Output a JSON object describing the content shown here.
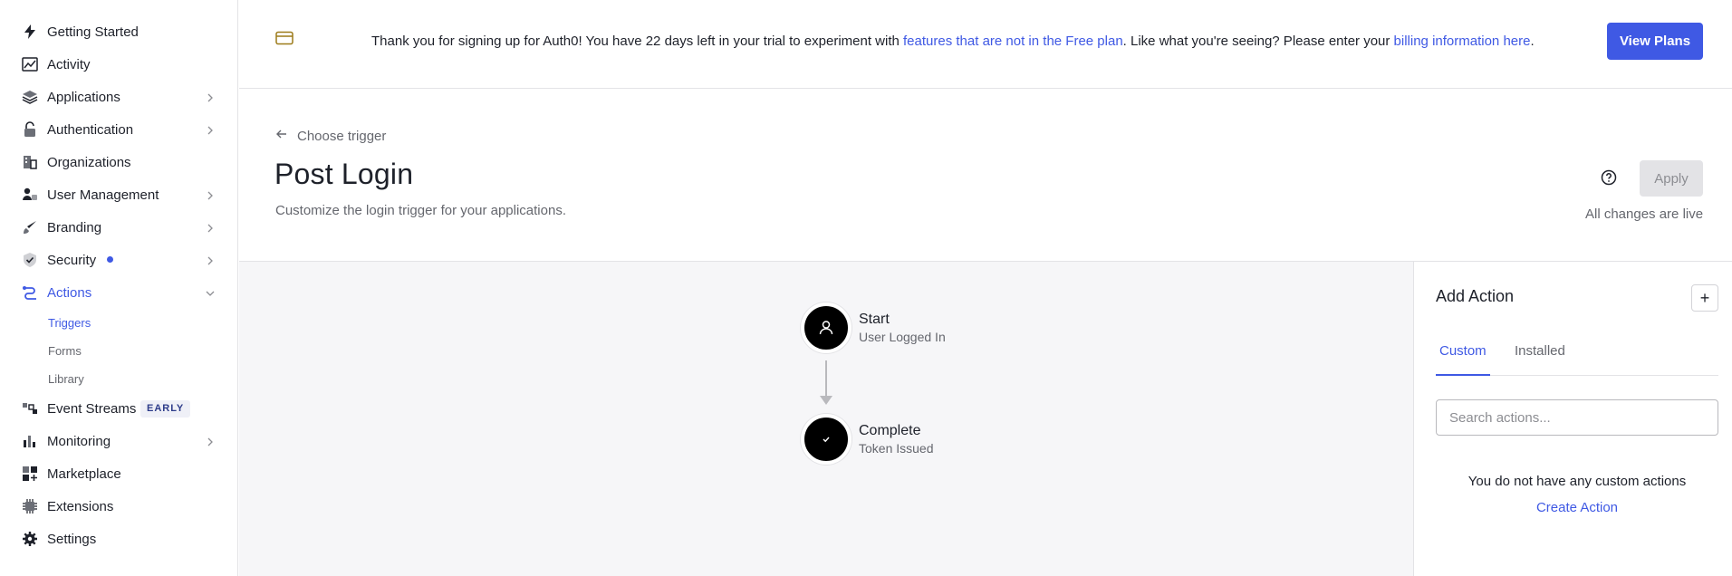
{
  "sidebar": {
    "items": [
      {
        "label": "Getting Started",
        "icon": "lightning-icon"
      },
      {
        "label": "Activity",
        "icon": "chart-line-icon"
      },
      {
        "label": "Applications",
        "icon": "layers-icon"
      },
      {
        "label": "Authentication",
        "icon": "lock-icon"
      },
      {
        "label": "Organizations",
        "icon": "building-icon"
      },
      {
        "label": "User Management",
        "icon": "users-icon"
      },
      {
        "label": "Branding",
        "icon": "brush-icon"
      },
      {
        "label": "Security",
        "icon": "shield-icon"
      },
      {
        "label": "Actions",
        "icon": "flow-icon"
      },
      {
        "label": "Event Streams",
        "icon": "stream-icon",
        "badge": "EARLY"
      },
      {
        "label": "Monitoring",
        "icon": "bar-chart-icon"
      },
      {
        "label": "Marketplace",
        "icon": "grid-plus-icon"
      },
      {
        "label": "Extensions",
        "icon": "chip-icon"
      },
      {
        "label": "Settings",
        "icon": "gear-icon"
      }
    ],
    "actions_sub": [
      "Triggers",
      "Forms",
      "Library"
    ],
    "accent": "#3f59e4"
  },
  "banner": {
    "text_1": "Thank you for signing up for Auth0! You have 22 days left in your trial to experiment with ",
    "link_1": "features that are not in the Free plan",
    "text_2": ". Like what you're seeing? Please enter your ",
    "link_2": "billing information here",
    "text_3": ".",
    "button": "View Plans"
  },
  "header": {
    "back_label": "Choose trigger",
    "title": "Post Login",
    "subtitle": "Customize the login trigger for your applications.",
    "apply": "Apply",
    "live_status": "All changes are live"
  },
  "flow": {
    "start": {
      "title": "Start",
      "subtitle": "User Logged In"
    },
    "complete": {
      "title": "Complete",
      "subtitle": "Token Issued"
    }
  },
  "panel": {
    "title": "Add Action",
    "add": "+",
    "tabs": [
      "Custom",
      "Installed"
    ],
    "search_placeholder": "Search actions...",
    "empty": "You do not have any custom actions",
    "create": "Create Action"
  }
}
